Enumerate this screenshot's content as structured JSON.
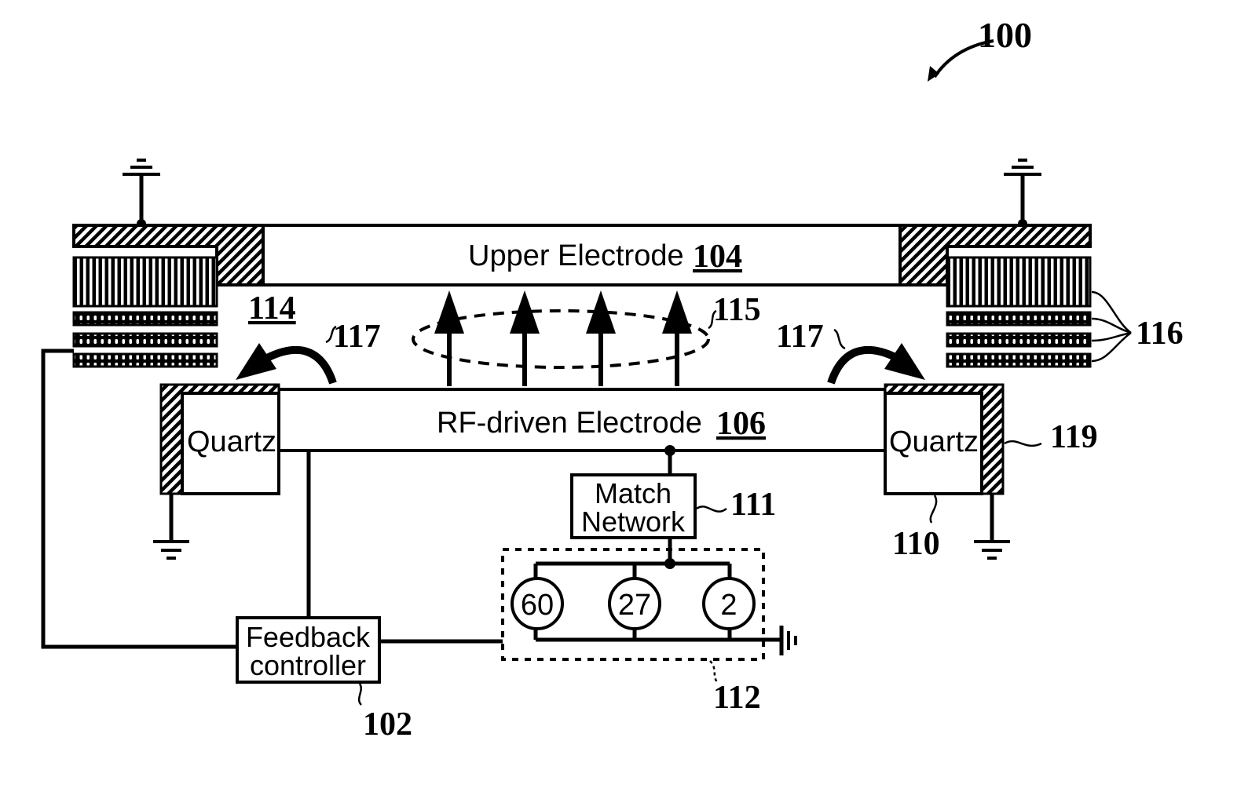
{
  "figure": {
    "ref_number": "100",
    "upper_electrode": {
      "label": "Upper Electrode",
      "ref": "104"
    },
    "rf_electrode": {
      "label": "RF-driven Electrode",
      "ref": "106"
    },
    "quartz_left": {
      "label": "Quartz"
    },
    "quartz_right": {
      "label": "Quartz",
      "ref": "110"
    },
    "conductive_layer_ref": "119",
    "plasma_region_ref": "114",
    "field_ref": "115",
    "coil_ref": "116",
    "flow_arrow_ref_left": "117",
    "flow_arrow_ref_right": "117",
    "match_network": {
      "line1": "Match",
      "line2": "Network",
      "ref": "111"
    },
    "rf_generators": {
      "ref": "112",
      "frequencies": [
        "60",
        "27",
        "2"
      ]
    },
    "feedback_controller": {
      "line1": "Feedback",
      "line2": "controller",
      "ref": "102"
    }
  }
}
